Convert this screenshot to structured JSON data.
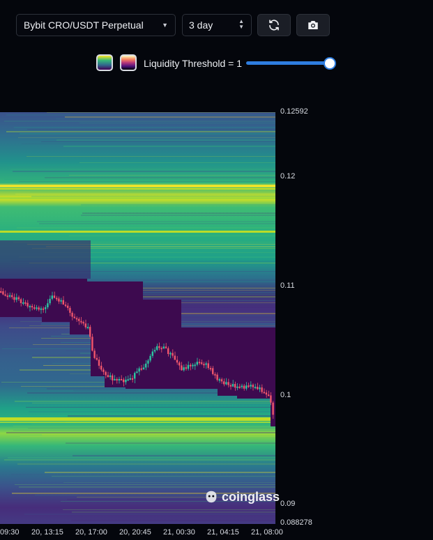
{
  "toolbar": {
    "pair_select": "Bybit CRO/USDT Perpetual",
    "range_select": "3 day",
    "refresh_icon": "refresh-icon",
    "screenshot_icon": "camera-icon"
  },
  "legend": {
    "scheme_1": "viridis",
    "scheme_2": "magma",
    "threshold_label": "Liquidity Threshold = 1",
    "threshold_value": 1
  },
  "y_axis": {
    "top": "0.12592",
    "t1": "0.12",
    "t2": "0.11",
    "t3": "0.1",
    "t4": "0.09",
    "bottom": "0.088278"
  },
  "x_axis": {
    "t0": "09:30",
    "t1": "20, 13:15",
    "t2": "20, 17:00",
    "t3": "20, 20:45",
    "t4": "21, 00:30",
    "t5": "21, 04:15",
    "t6": "21, 08:00"
  },
  "brand": "coinglass",
  "colors": {
    "background": "#04060c",
    "accent": "#2e7de0",
    "candle_up": "#2bc7a2",
    "candle_down": "#f0566c",
    "void": "#3d0a4f"
  }
}
